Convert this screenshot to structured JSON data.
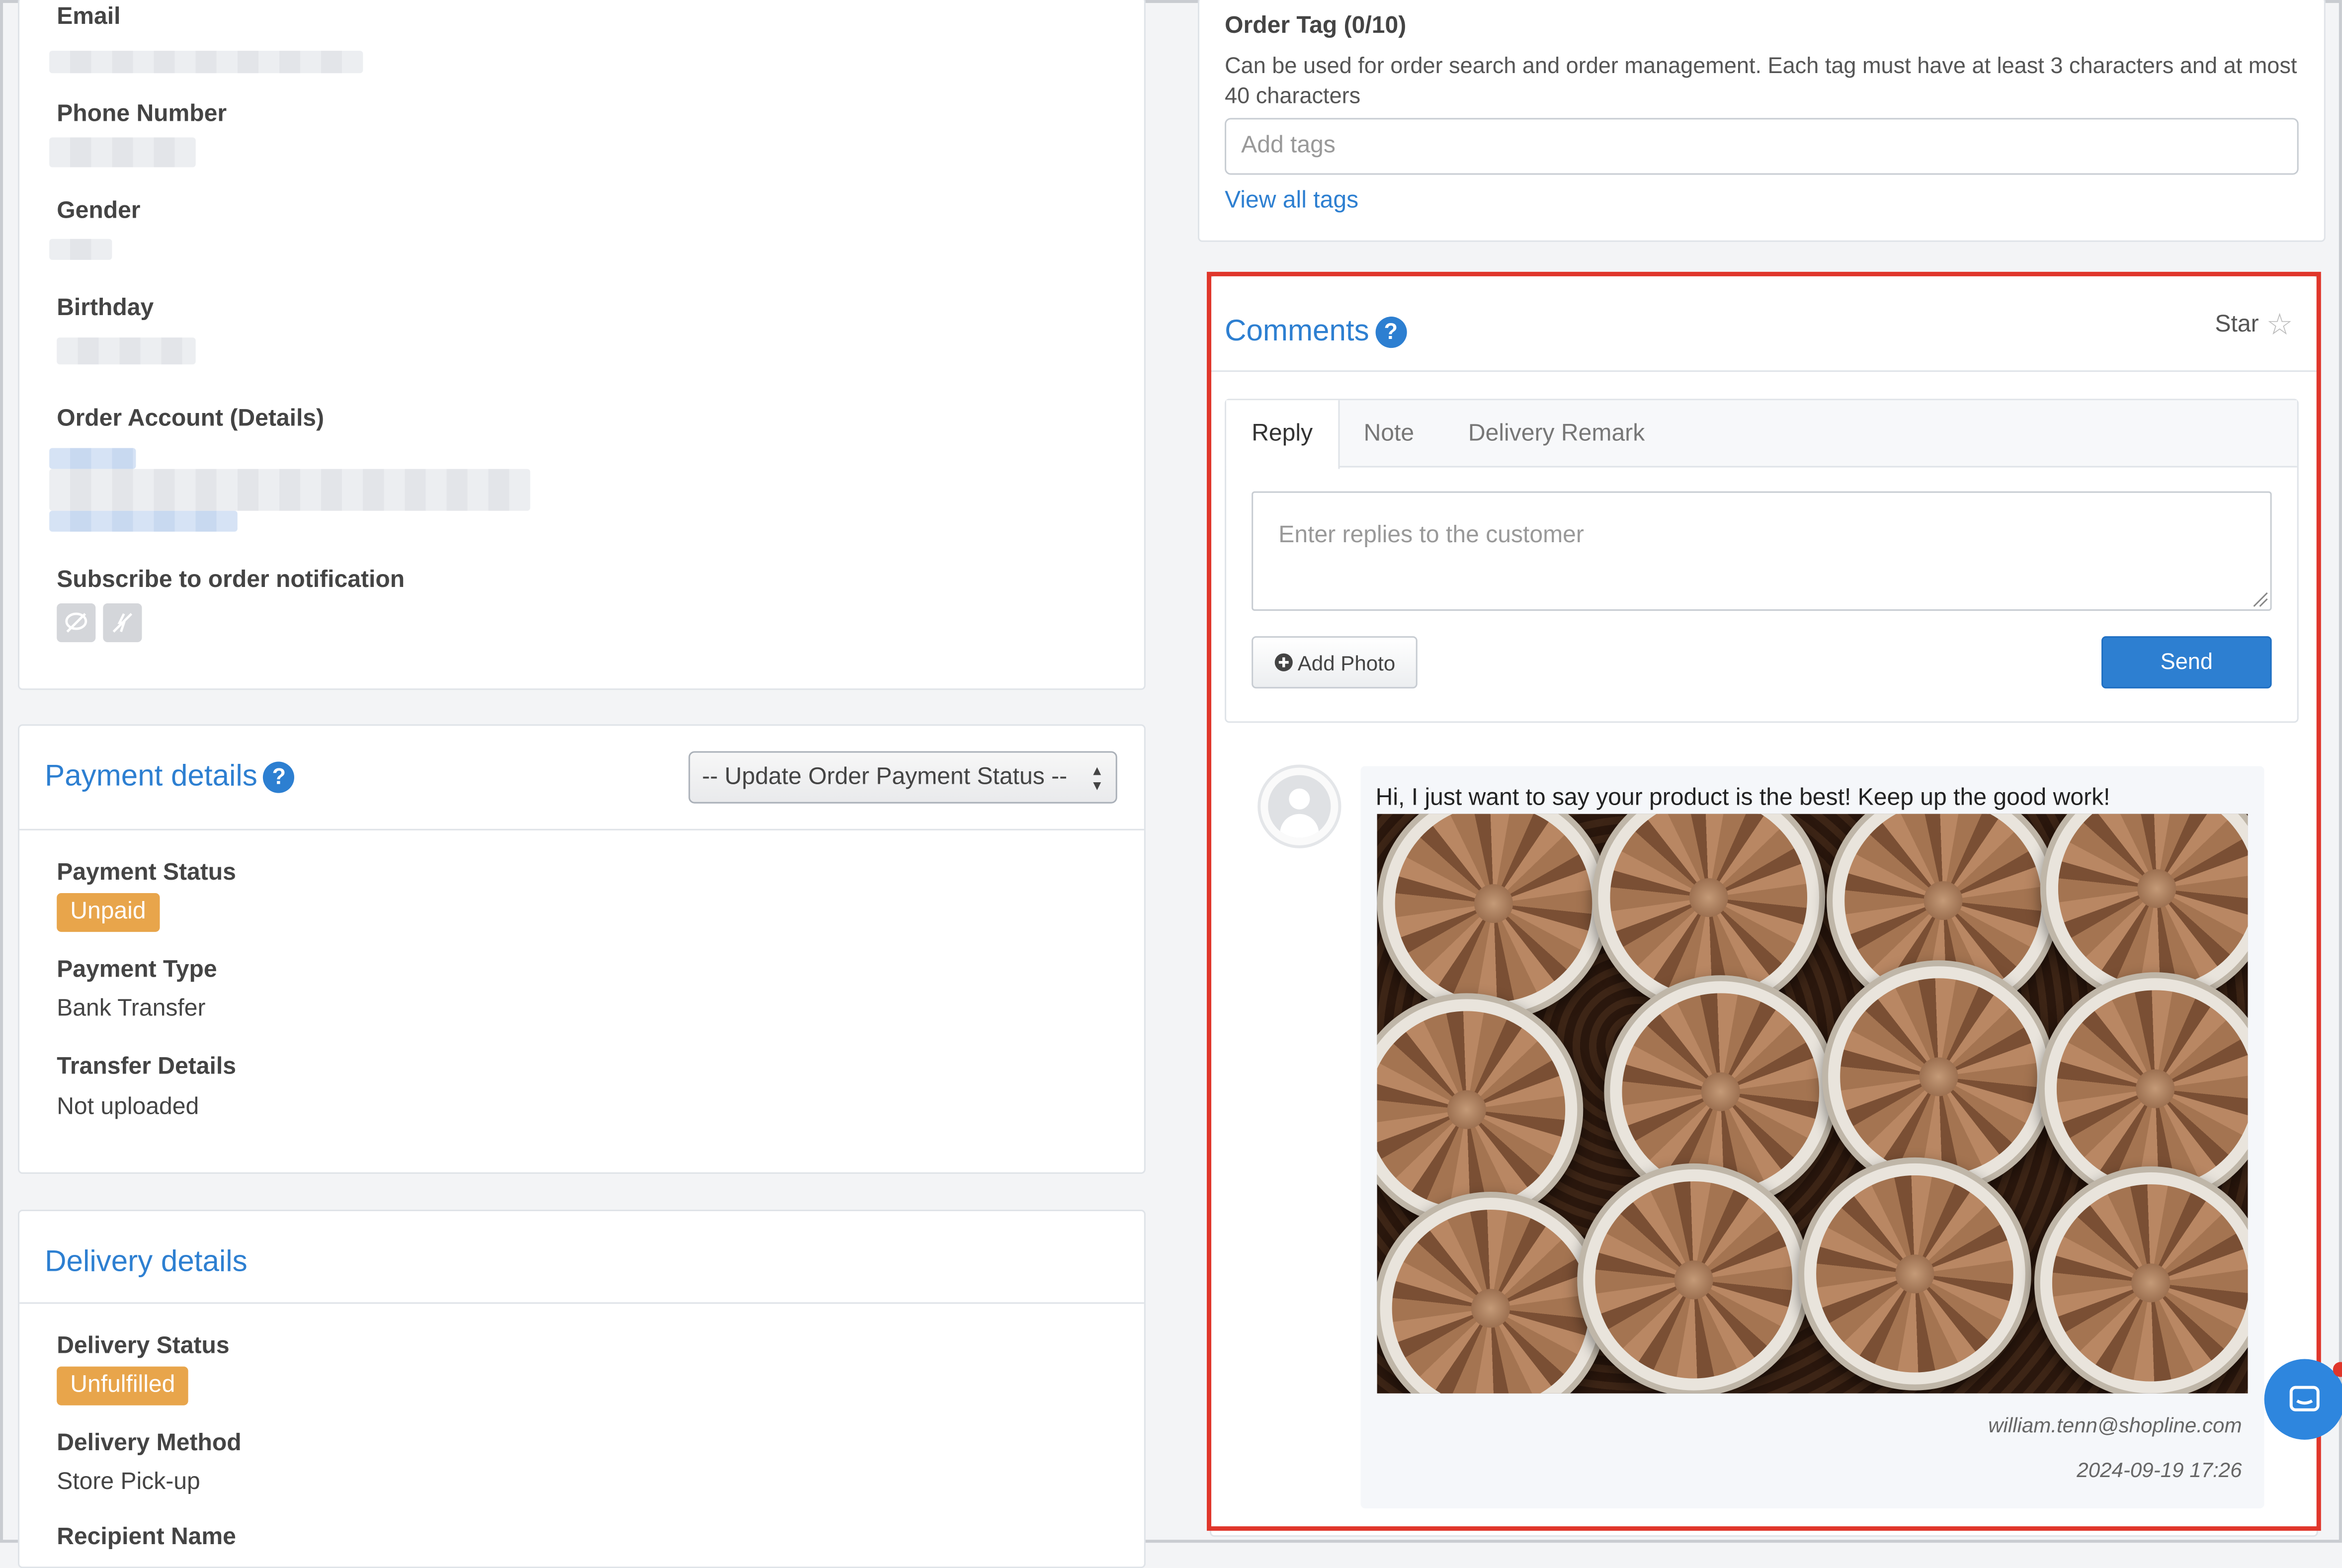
{
  "customer": {
    "email_label": "Email",
    "phone_label": "Phone Number",
    "gender_label": "Gender",
    "birthday_label": "Birthday",
    "order_account_label": "Order Account (Details)",
    "subscribe_label": "Subscribe to order notification"
  },
  "payment": {
    "title": "Payment details",
    "update_select": "-- Update Order Payment Status --",
    "status_label": "Payment Status",
    "status_value": "Unpaid",
    "type_label": "Payment Type",
    "type_value": "Bank Transfer",
    "transfer_label": "Transfer Details",
    "transfer_value": "Not uploaded"
  },
  "delivery": {
    "title": "Delivery details",
    "status_label": "Delivery Status",
    "status_value": "Unfulfilled",
    "method_label": "Delivery Method",
    "method_value": "Store Pick-up",
    "recipient_label": "Recipient Name"
  },
  "order_tag": {
    "title": "Order Tag (0/10)",
    "description": "Can be used for order search and order management. Each tag must have at least 3 characters and at most 40 characters",
    "input_placeholder": "Add tags",
    "view_all": "View all tags"
  },
  "comments": {
    "title": "Comments",
    "star_label": "Star",
    "tabs": [
      "Reply",
      "Note",
      "Delivery Remark"
    ],
    "reply_placeholder": "Enter replies to the customer",
    "add_photo": "Add Photo",
    "send": "Send",
    "message": {
      "text": "Hi, I just want to say your product is the best! Keep up the good work!",
      "author": "william.tenn@shopline.com",
      "timestamp": "2024-09-19 17:26"
    }
  },
  "colors": {
    "accent": "#2d7fd1",
    "badge": "#e8a54b",
    "highlight": "#e0362b"
  }
}
